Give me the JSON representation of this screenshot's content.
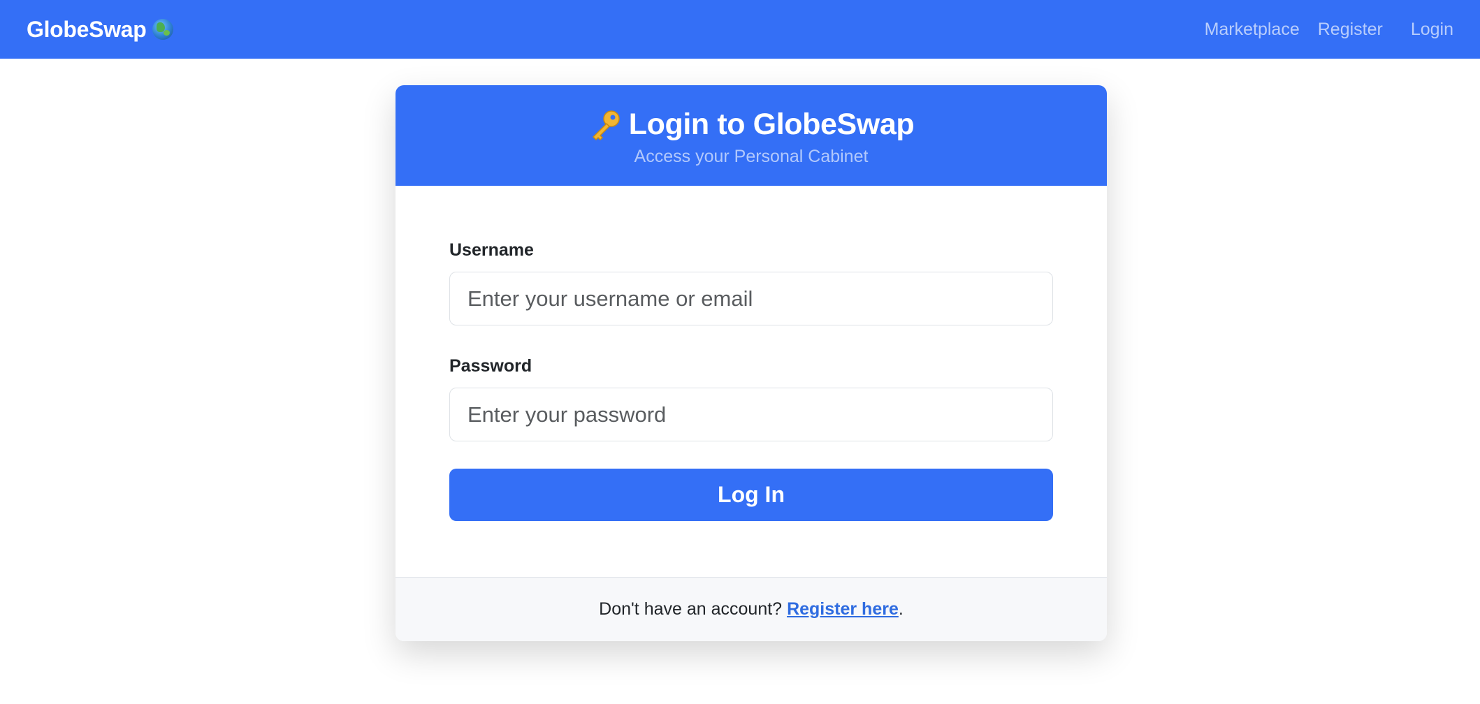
{
  "navbar": {
    "brand": "GlobeSwap",
    "links": [
      {
        "label": "Marketplace"
      },
      {
        "label": "Register"
      },
      {
        "label": "Login"
      }
    ]
  },
  "login_card": {
    "title": "Login to GlobeSwap",
    "subtitle": "Access your Personal Cabinet",
    "username": {
      "label": "Username",
      "value": "",
      "placeholder": "Enter your username or email"
    },
    "password": {
      "label": "Password",
      "value": "",
      "placeholder": "Enter your password"
    },
    "submit_label": "Log In",
    "footer": {
      "prefix": "Don't have an account?",
      "link": "Register here",
      "suffix": "."
    }
  },
  "colors": {
    "primary": "#346ff6",
    "link": "#2f6ce0",
    "footer_bg": "#f7f8fa"
  },
  "icons": {
    "brand": "globe-icon",
    "title": "key-icon"
  }
}
